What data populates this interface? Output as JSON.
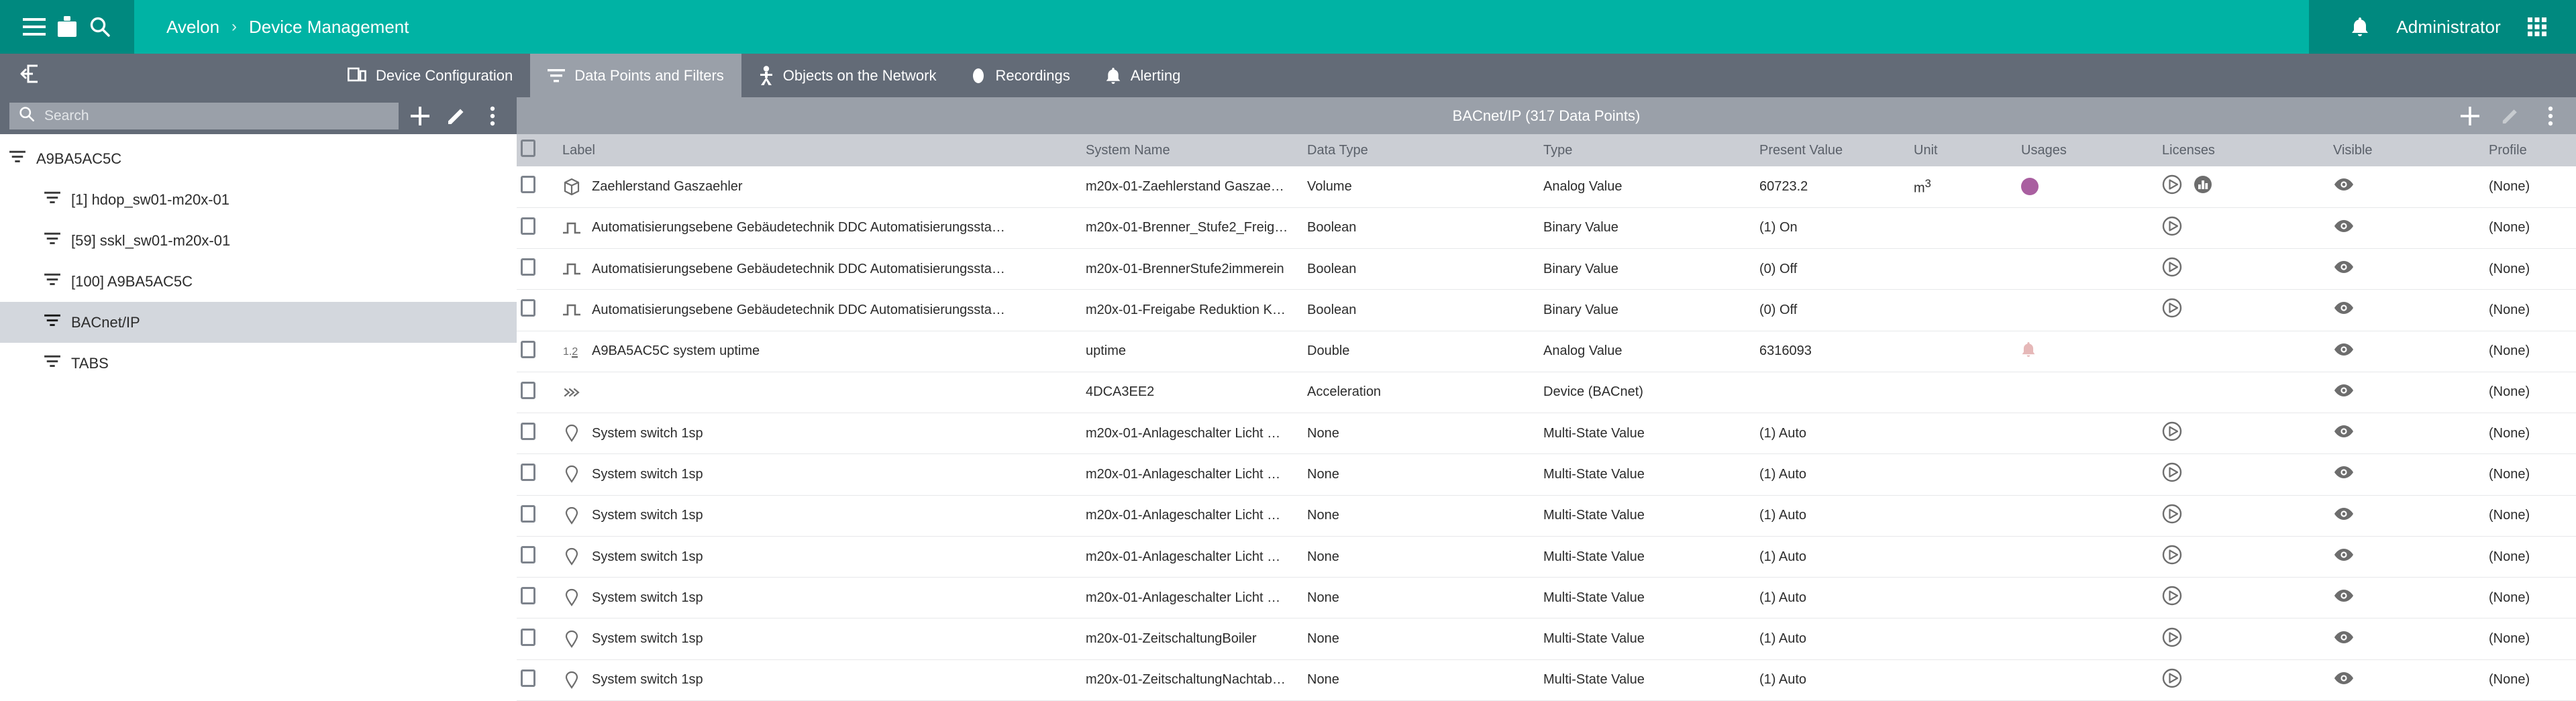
{
  "topbar": {
    "menu_icon": "hamburger-icon",
    "briefcase_icon": "briefcase-icon",
    "search_icon": "search-icon",
    "breadcrumb": [
      "Avelon",
      "Device Management"
    ],
    "breadcrumb_separator": "›",
    "notification_icon": "bell-icon",
    "user": "Administrator",
    "apps_icon": "apps-grid-icon",
    "accent_color": "#00b3a4",
    "accent_dark_color": "#00897f"
  },
  "tabbar": {
    "collapse_icon": "collapse-panel-icon",
    "tabs": [
      {
        "label": "Device Configuration",
        "icon": "devices-icon",
        "active": false
      },
      {
        "label": "Data Points and Filters",
        "icon": "filter-icon",
        "active": true
      },
      {
        "label": "Objects on the Network",
        "icon": "network-objects-icon",
        "active": false
      },
      {
        "label": "Recordings",
        "icon": "record-icon",
        "active": false
      },
      {
        "label": "Alerting",
        "icon": "bell-icon",
        "active": false
      }
    ],
    "bar_color": "#636b77",
    "active_color": "#9aa0a9"
  },
  "sidebar": {
    "search": {
      "placeholder": "Search",
      "value": "",
      "icon": "search-icon"
    },
    "actions": [
      {
        "name": "add",
        "icon": "plus-icon"
      },
      {
        "name": "edit",
        "icon": "pencil-icon"
      },
      {
        "name": "more",
        "icon": "more-vertical-icon"
      }
    ],
    "tree": [
      {
        "label": "A9BA5AC5C",
        "icon": "filter-icon",
        "level": 0,
        "selected": false
      },
      {
        "label": "[1] hdop_sw01-m20x-01",
        "icon": "filter-icon",
        "level": 1,
        "selected": false
      },
      {
        "label": "[59] sskl_sw01-m20x-01",
        "icon": "filter-icon",
        "level": 1,
        "selected": false
      },
      {
        "label": "[100] A9BA5AC5C",
        "icon": "filter-icon",
        "level": 1,
        "selected": false
      },
      {
        "label": "BACnet/IP",
        "icon": "filter-icon",
        "level": 1,
        "selected": true
      },
      {
        "label": "TABS",
        "icon": "filter-icon",
        "level": 1,
        "selected": false
      }
    ]
  },
  "content": {
    "title": "BACnet/IP (317 Data Points)",
    "actions": [
      {
        "name": "add",
        "icon": "plus-icon",
        "disabled": false
      },
      {
        "name": "edit",
        "icon": "pencil-icon",
        "disabled": true
      },
      {
        "name": "more",
        "icon": "more-vertical-icon",
        "disabled": false
      }
    ],
    "columns": [
      "Label",
      "System Name",
      "Data Type",
      "Type",
      "Present Value",
      "Unit",
      "Usages",
      "Licenses",
      "Visible",
      "Profile"
    ],
    "select_all_checked": false,
    "rows": [
      {
        "checked": false,
        "icon": "cube-icon",
        "label": "Zaehlerstand Gaszaehler",
        "system_name": "m20x-01-Zaehlerstand Gaszae…",
        "data_type": "Volume",
        "type": "Analog Value",
        "present_value": "60723.2",
        "unit": "m³",
        "usages": [
          {
            "kind": "dot",
            "color": "#a95fa0"
          }
        ],
        "licenses": [
          {
            "kind": "play"
          },
          {
            "kind": "chart"
          }
        ],
        "visible": "eye-icon",
        "profile": "(None)"
      },
      {
        "checked": false,
        "icon": "pulse-icon",
        "label": "Automatisierungsebene Gebäudetechnik DDC Automatisierungssta…",
        "system_name": "m20x-01-Brenner_Stufe2_Freig…",
        "data_type": "Boolean",
        "type": "Binary Value",
        "present_value": "(1) On",
        "unit": "",
        "usages": [],
        "licenses": [
          {
            "kind": "play"
          }
        ],
        "visible": "eye-icon",
        "profile": "(None)"
      },
      {
        "checked": false,
        "icon": "pulse-icon",
        "label": "Automatisierungsebene Gebäudetechnik DDC Automatisierungssta…",
        "system_name": "m20x-01-BrennerStufe2immerein",
        "data_type": "Boolean",
        "type": "Binary Value",
        "present_value": "(0) Off",
        "unit": "",
        "usages": [],
        "licenses": [
          {
            "kind": "play"
          }
        ],
        "visible": "eye-icon",
        "profile": "(None)"
      },
      {
        "checked": false,
        "icon": "pulse-icon",
        "label": "Automatisierungsebene Gebäudetechnik DDC Automatisierungssta…",
        "system_name": "m20x-01-Freigabe Reduktion K…",
        "data_type": "Boolean",
        "type": "Binary Value",
        "present_value": "(0) Off",
        "unit": "",
        "usages": [],
        "licenses": [
          {
            "kind": "play"
          }
        ],
        "visible": "eye-icon",
        "profile": "(None)"
      },
      {
        "checked": false,
        "icon": "number-icon",
        "label": "A9BA5AC5C system uptime",
        "system_name": "uptime",
        "data_type": "Double",
        "type": "Analog Value",
        "present_value": "6316093",
        "unit": "",
        "usages": [
          {
            "kind": "bell",
            "color": "#e6b8b8"
          }
        ],
        "licenses": [],
        "visible": "eye-icon",
        "profile": "(None)"
      },
      {
        "checked": false,
        "icon": "chevrons-icon",
        "label": "",
        "system_name": "4DCA3EE2",
        "data_type": "Acceleration",
        "type": "Device (BACnet)",
        "present_value": "",
        "unit": "",
        "usages": [],
        "licenses": [],
        "visible": "eye-icon",
        "profile": "(None)"
      },
      {
        "checked": false,
        "icon": "pin-icon",
        "label": "System switch 1sp",
        "system_name": "m20x-01-Anlageschalter Licht …",
        "data_type": "None",
        "type": "Multi-State Value",
        "present_value": "(1) Auto",
        "unit": "",
        "usages": [],
        "licenses": [
          {
            "kind": "play"
          }
        ],
        "visible": "eye-icon",
        "profile": "(None)"
      },
      {
        "checked": false,
        "icon": "pin-icon",
        "label": "System switch 1sp",
        "system_name": "m20x-01-Anlageschalter Licht …",
        "data_type": "None",
        "type": "Multi-State Value",
        "present_value": "(1) Auto",
        "unit": "",
        "usages": [],
        "licenses": [
          {
            "kind": "play"
          }
        ],
        "visible": "eye-icon",
        "profile": "(None)"
      },
      {
        "checked": false,
        "icon": "pin-icon",
        "label": "System switch 1sp",
        "system_name": "m20x-01-Anlageschalter Licht …",
        "data_type": "None",
        "type": "Multi-State Value",
        "present_value": "(1) Auto",
        "unit": "",
        "usages": [],
        "licenses": [
          {
            "kind": "play"
          }
        ],
        "visible": "eye-icon",
        "profile": "(None)"
      },
      {
        "checked": false,
        "icon": "pin-icon",
        "label": "System switch 1sp",
        "system_name": "m20x-01-Anlageschalter Licht …",
        "data_type": "None",
        "type": "Multi-State Value",
        "present_value": "(1) Auto",
        "unit": "",
        "usages": [],
        "licenses": [
          {
            "kind": "play"
          }
        ],
        "visible": "eye-icon",
        "profile": "(None)"
      },
      {
        "checked": false,
        "icon": "pin-icon",
        "label": "System switch 1sp",
        "system_name": "m20x-01-Anlageschalter Licht …",
        "data_type": "None",
        "type": "Multi-State Value",
        "present_value": "(1) Auto",
        "unit": "",
        "usages": [],
        "licenses": [
          {
            "kind": "play"
          }
        ],
        "visible": "eye-icon",
        "profile": "(None)"
      },
      {
        "checked": false,
        "icon": "pin-icon",
        "label": "System switch 1sp",
        "system_name": "m20x-01-ZeitschaltungBoiler",
        "data_type": "None",
        "type": "Multi-State Value",
        "present_value": "(1) Auto",
        "unit": "",
        "usages": [],
        "licenses": [
          {
            "kind": "play"
          }
        ],
        "visible": "eye-icon",
        "profile": "(None)"
      },
      {
        "checked": false,
        "icon": "pin-icon",
        "label": "System switch 1sp",
        "system_name": "m20x-01-ZeitschaltungNachtab…",
        "data_type": "None",
        "type": "Multi-State Value",
        "present_value": "(1) Auto",
        "unit": "",
        "usages": [],
        "licenses": [
          {
            "kind": "play"
          }
        ],
        "visible": "eye-icon",
        "profile": "(None)"
      }
    ]
  },
  "scrollbar": {
    "up_arrow_icon": "triangle-up-icon"
  }
}
